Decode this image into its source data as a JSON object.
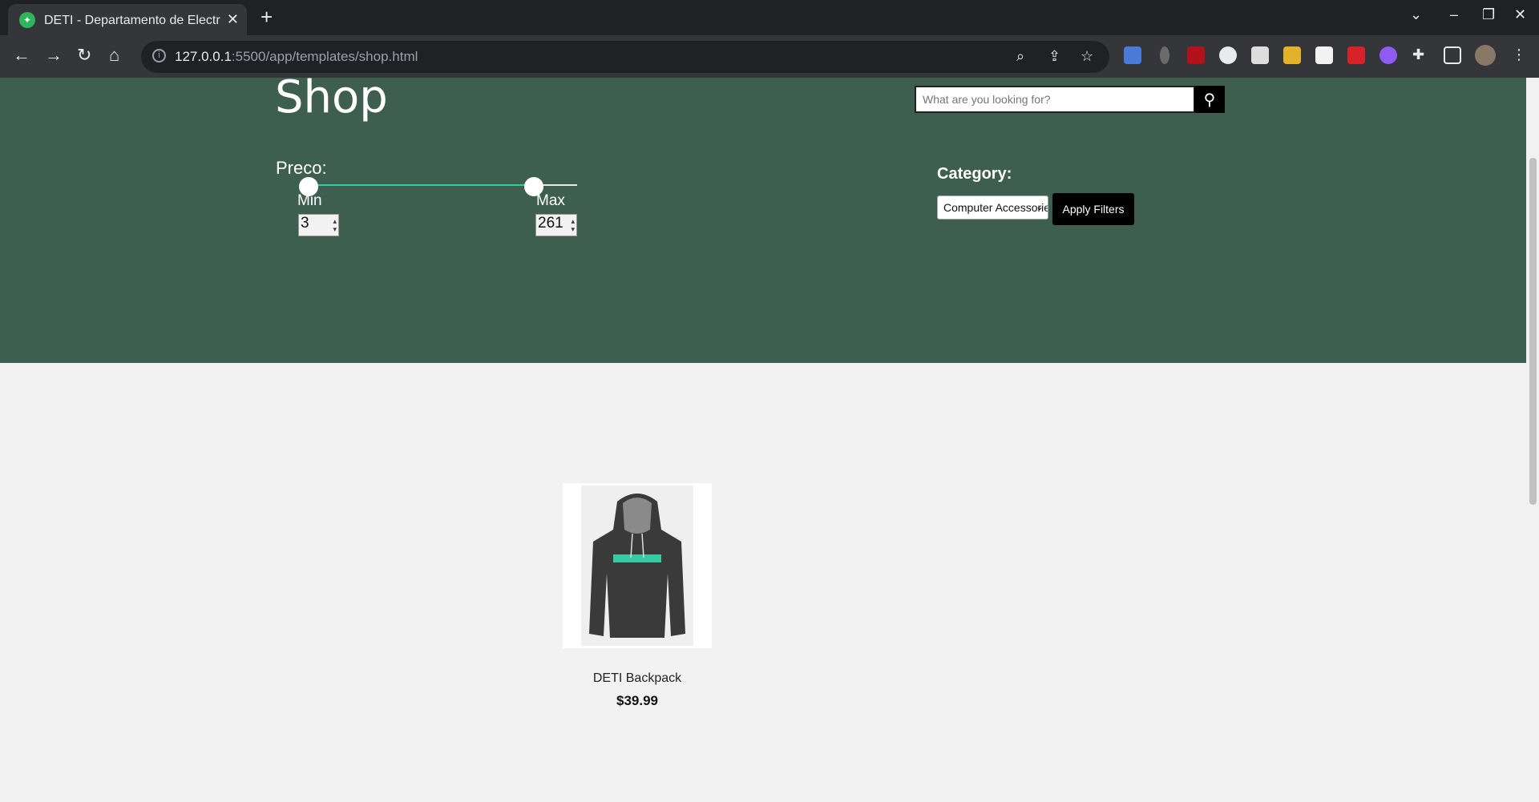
{
  "browser": {
    "tab_title": "DETI - Departamento de Electrónica",
    "url_host": "127.0.0.1",
    "url_rest": ":5500/app/templates/shop.html"
  },
  "hero": {
    "title": "Shop",
    "search_placeholder": "What are you looking for?",
    "price_label": "Preco:",
    "min_label": "Min",
    "max_label": "Max",
    "min_value": "3",
    "max_value": "261",
    "category_label": "Category:",
    "category_selected": "Computer Accessories",
    "apply_label": "Apply Filters"
  },
  "products": [
    {
      "name": "DETI Backpack",
      "price": "$39.99"
    }
  ],
  "colors": {
    "hero_bg": "#3e5e50",
    "slider_accent": "#37c9a2",
    "page_bg": "#f2f2f2"
  }
}
